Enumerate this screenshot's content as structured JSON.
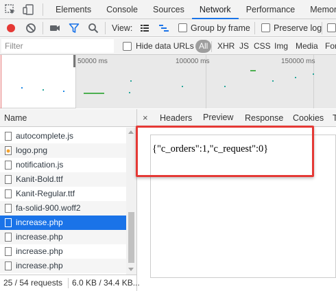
{
  "tabs": [
    "Elements",
    "Console",
    "Sources",
    "Network",
    "Performance",
    "Memory"
  ],
  "active_tab": "Network",
  "toolbar": {
    "view_label": "View:",
    "group_by_frame": "Group by frame",
    "preserve_log": "Preserve log"
  },
  "filterbar": {
    "placeholder": "Filter",
    "hide_data_urls": "Hide data URLs",
    "types": [
      "All",
      "XHR",
      "JS",
      "CSS",
      "Img",
      "Media",
      "For"
    ]
  },
  "overview": {
    "ticks": [
      "50000 ms",
      "100000 ms",
      "150000 ms"
    ]
  },
  "list": {
    "header": "Name",
    "items": [
      {
        "name": "autocomplete.js",
        "icon": "document-icon"
      },
      {
        "name": "logo.png",
        "icon": "image-icon"
      },
      {
        "name": "notification.js",
        "icon": "document-icon"
      },
      {
        "name": "Kanit-Bold.ttf",
        "icon": "document-icon"
      },
      {
        "name": "Kanit-Regular.ttf",
        "icon": "document-icon"
      },
      {
        "name": "fa-solid-900.woff2",
        "icon": "document-icon"
      },
      {
        "name": "increase.php",
        "icon": "document-icon",
        "selected": true
      },
      {
        "name": "increase.php",
        "icon": "document-icon"
      },
      {
        "name": "increase.php",
        "icon": "document-icon"
      },
      {
        "name": "increase.php",
        "icon": "document-icon"
      }
    ]
  },
  "status": {
    "requests": "25 / 54 requests",
    "transferred": "6.0 KB / 34.4 KB..."
  },
  "detail": {
    "close": "×",
    "tabs": [
      "Headers",
      "Preview",
      "Response",
      "Cookies"
    ],
    "active_tab": "Preview",
    "preview_text": "{\"c_orders\":1,\"c_request\":0}"
  },
  "colors": {
    "accent": "#1a73e8",
    "record": "#e53935",
    "highlight": "#e53935"
  }
}
